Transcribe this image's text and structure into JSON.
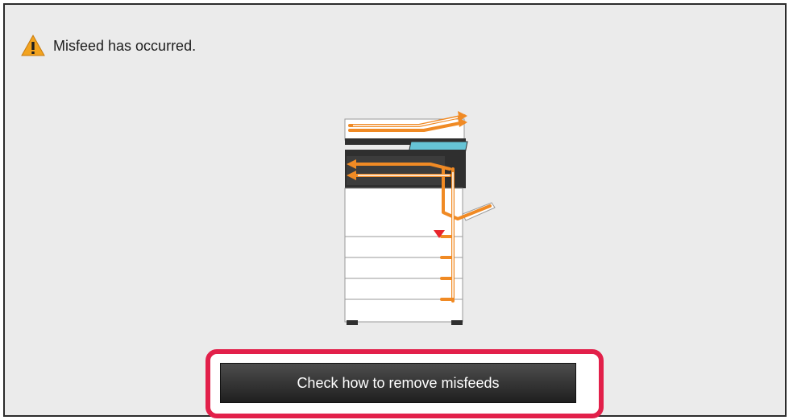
{
  "alert": {
    "icon": "warning-icon",
    "message": "Misfeed has occurred."
  },
  "illustration": {
    "icon": "printer-misfeed-diagram",
    "colors": {
      "path": "#f08a24",
      "warning": "#e8242b",
      "panel": "#66c4d6",
      "body": "#ffffff",
      "dark": "#2f2f2f"
    }
  },
  "action": {
    "label": "Check how to remove misfeeds",
    "highlight_color": "#e2204a"
  }
}
